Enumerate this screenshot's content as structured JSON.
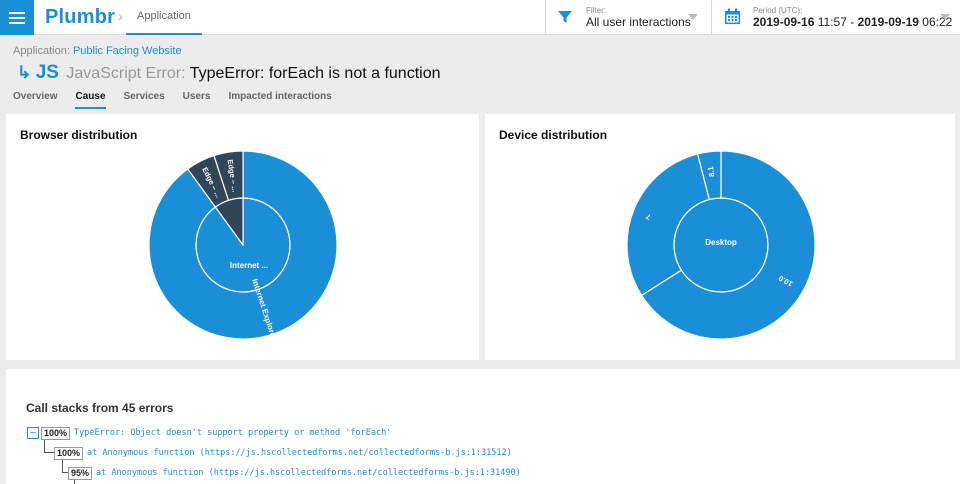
{
  "topbar": {
    "logo": "Plumbr",
    "breadcrumb_separator": "›",
    "breadcrumb_tab": "Application",
    "filter_label": "Filter:",
    "filter_value": "All user interactions",
    "period_label": "Period (UTC):",
    "period_start_date": "2019-09-16",
    "period_start_time": "11:57",
    "period_dash": "-",
    "period_end_date": "2019-09-19",
    "period_end_time": "06:22"
  },
  "header": {
    "application_prefix": "Application:",
    "application_name": "Public Facing Website",
    "arrow": "↳",
    "badge": "JS",
    "error_kind": "JavaScript Error:",
    "error_message": "TypeError: forEach is not a function"
  },
  "tabs": [
    "Overview",
    "Cause",
    "Services",
    "Users",
    "Impacted interactions"
  ],
  "active_tab": "Cause",
  "colors": {
    "accent": "#1a8fd8",
    "slice_blue": "#1a8fd8",
    "slice_dark": "#2f4558"
  },
  "browser_distribution": {
    "title": "Browser distribution",
    "inner_label": "Internet ...",
    "outer_slices": [
      {
        "label": "Internet Explorer – 11.0",
        "fraction": 0.9,
        "color": "#1a8fd8"
      },
      {
        "label": "Edge – ...",
        "fraction": 0.05,
        "color": "#2f4558"
      },
      {
        "label": "Edge – ...",
        "fraction": 0.05,
        "color": "#2f4558"
      }
    ],
    "inner_slices": [
      {
        "label": "Internet ...",
        "fraction": 0.9,
        "color": "#1a8fd8"
      },
      {
        "label": "Edge",
        "fraction": 0.1,
        "color": "#2f4558"
      }
    ]
  },
  "device_distribution": {
    "title": "Device distribution",
    "inner_label": "Desktop",
    "outer_slices": [
      {
        "label": "10.0",
        "fraction": 0.66,
        "color": "#1a8fd8"
      },
      {
        "label": "7",
        "fraction": 0.3,
        "color": "#1a8fd8"
      },
      {
        "label": "8.1",
        "fraction": 0.04,
        "color": "#1a8fd8"
      }
    ]
  },
  "call_stacks": {
    "title": "Call stacks from 45 errors",
    "toggle_symbol": "−",
    "frames": [
      {
        "percent": "100%",
        "text": "TypeError: Object doesn't support property or method 'forEach'"
      },
      {
        "percent": "100%",
        "text": "at Anonymous function (https://js.hscollectedforms.net/collectedforms-b.js:1:31512)"
      },
      {
        "percent": "95%",
        "text": "at Anonymous function (https://js.hscollectedforms.net/collectedforms-b.js:1:31490)"
      }
    ]
  }
}
